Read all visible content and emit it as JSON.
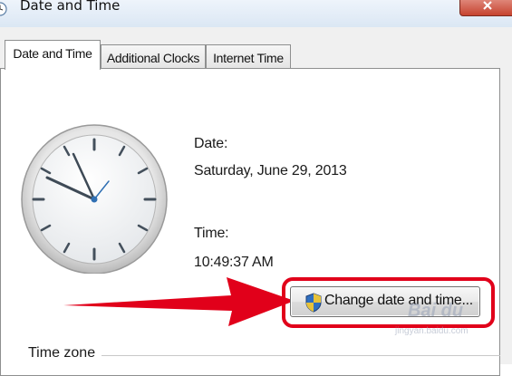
{
  "window": {
    "title": "Date and Time",
    "icon": "date-time-app-icon",
    "close_icon": "close-icon"
  },
  "tabs": [
    {
      "label": "Date and Time",
      "active": true
    },
    {
      "label": "Additional Clocks",
      "active": false
    },
    {
      "label": "Internet Time",
      "active": false
    }
  ],
  "clock": {
    "icon": "analog-clock",
    "time_shown": "10:49:37"
  },
  "date": {
    "label": "Date:",
    "value": "Saturday, June 29, 2013"
  },
  "time": {
    "label": "Time:",
    "value": "10:49:37 AM"
  },
  "change_button": {
    "label": "Change date and time...",
    "icon": "uac-shield-icon"
  },
  "time_zone": {
    "label": "Time zone"
  },
  "annotation": {
    "arrow_color": "#e1001a",
    "highlight_color": "#e1001a"
  },
  "watermark": {
    "brand": "Bai du",
    "site": "jingyan.baidu.com"
  },
  "colors": {
    "title_bar": "#dbe7f4",
    "dialog_bg": "#f0f0f0",
    "close_button": "#c6432f"
  }
}
